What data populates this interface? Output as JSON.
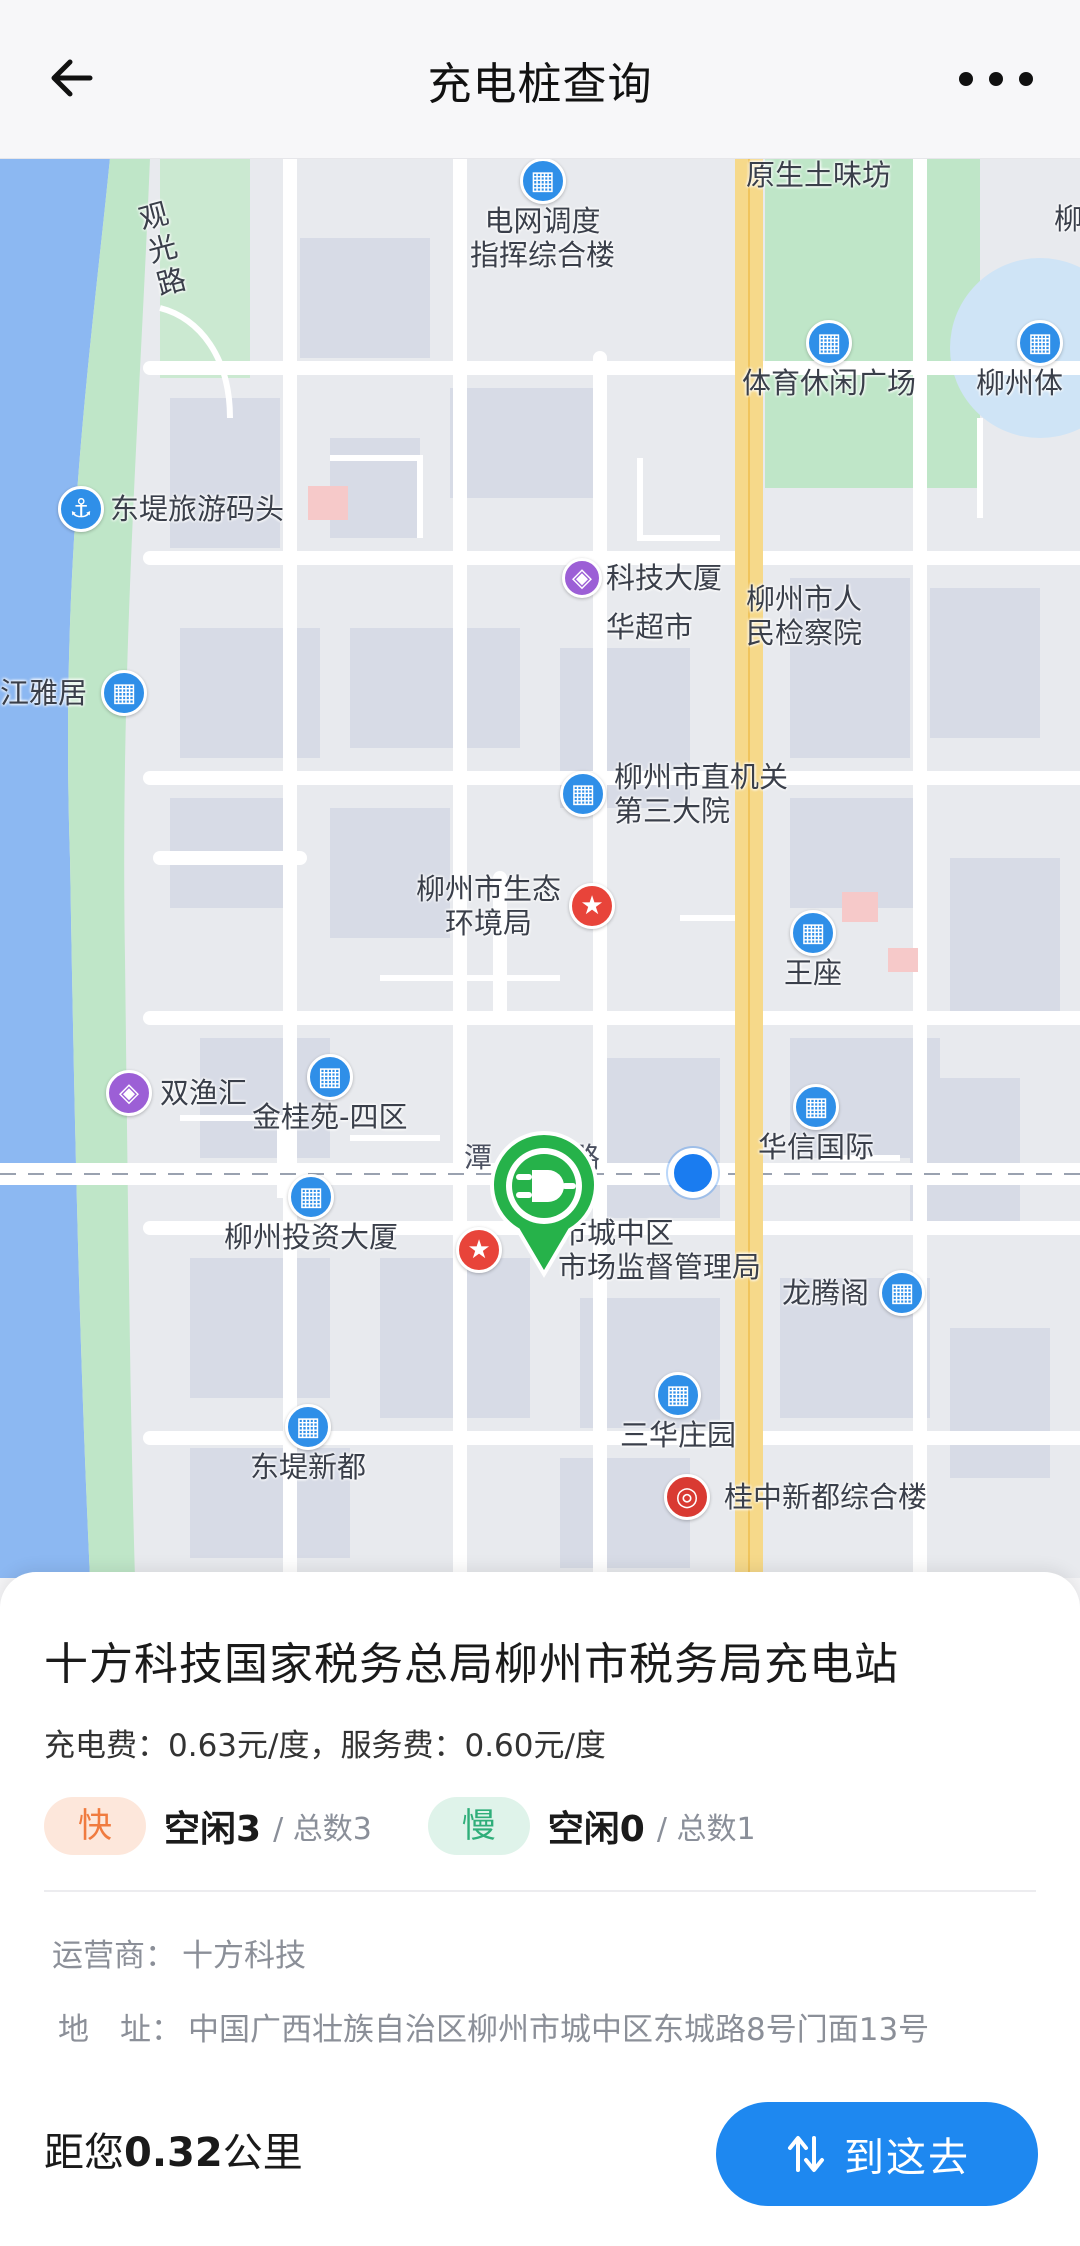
{
  "header": {
    "title": "充电桩查询",
    "back_icon": "arrow-left-icon",
    "more_icon": "more-dots-icon"
  },
  "map": {
    "pois": [
      {
        "label": "电网调度\n指挥综合楼",
        "icon": "building-icon"
      },
      {
        "label": "原生土味坊",
        "icon": ""
      },
      {
        "label": "观\n光\n路",
        "icon": ""
      },
      {
        "label": "体育休闲广场",
        "icon": "building-icon"
      },
      {
        "label": "柳州体",
        "icon": "building-icon"
      },
      {
        "label": "柳",
        "icon": ""
      },
      {
        "label": "东堤旅游码头",
        "icon": "anchor-icon"
      },
      {
        "label": "科技大厦",
        "icon": "shop-icon"
      },
      {
        "label": "华超市",
        "icon": ""
      },
      {
        "label": "柳州市人\n民检察院",
        "icon": ""
      },
      {
        "label": "江雅居",
        "icon": "building-icon"
      },
      {
        "label": "柳州市直机关\n第三大院",
        "icon": "building-icon"
      },
      {
        "label": "柳州市生态\n环境局",
        "icon": "star-icon"
      },
      {
        "label": "双渔汇",
        "icon": "shop-icon"
      },
      {
        "label": "王座",
        "icon": "building-icon"
      },
      {
        "label": "金桂苑-四区",
        "icon": "building-icon"
      },
      {
        "label": "华信国际",
        "icon": "building-icon"
      },
      {
        "label": "潭",
        "icon": ""
      },
      {
        "label": "路",
        "icon": ""
      },
      {
        "label": "柳州投资大厦",
        "icon": "building-icon"
      },
      {
        "label": "市城中区\n市场监督管理局",
        "icon": "star-icon"
      },
      {
        "label": "龙腾阁",
        "icon": "building-icon"
      },
      {
        "label": "三华庄园",
        "icon": "building-icon"
      },
      {
        "label": "东堤新都",
        "icon": "building-icon"
      },
      {
        "label": "桂中新都综合楼",
        "icon": "bank-icon"
      }
    ],
    "charger_icon": "ev-plug-icon",
    "location_icon": "current-location-icon",
    "close_icon": "close-icon"
  },
  "card": {
    "station_name": "十方科技国家税务总局柳州市税务局充电站",
    "charge_fee": "充电费：0.63元/度，",
    "service_fee": "服务费：0.60元/度",
    "fast": {
      "tag": "快",
      "idle": "空闲3",
      "total": "/ 总数3"
    },
    "slow": {
      "tag": "慢",
      "idle": "空闲0",
      "total": "/ 总数1"
    },
    "operator_label": "运营商：",
    "operator_value": "十方科技",
    "address_label": "地　址：",
    "address_value": "中国广西壮族自治区柳州市城中区东城路8号门面13号",
    "distance_prefix": "距您",
    "distance_value": "0.32",
    "distance_unit": "公里",
    "nav_label": "到这去",
    "nav_icon": "route-arrows-icon"
  },
  "colors": {
    "accent": "#1e88f0",
    "fast_tag": "#f07b3f",
    "slow_tag": "#2fae7a",
    "charger_pin": "#26b24a",
    "river": "#8cb8f2",
    "main_road": "#f6d98a"
  }
}
